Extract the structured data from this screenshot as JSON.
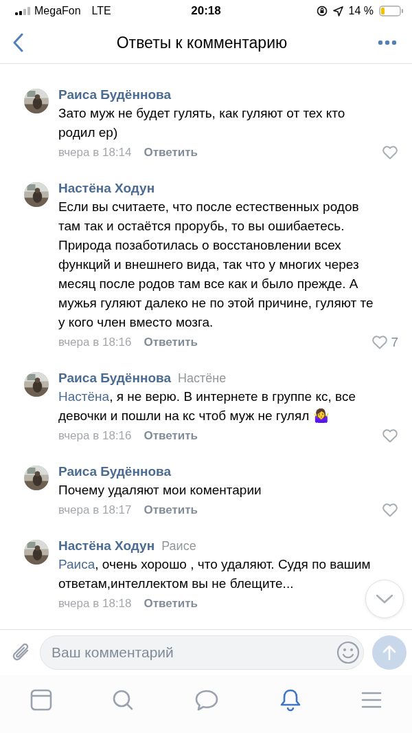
{
  "status_bar": {
    "carrier": "MegaFon",
    "network": "LTE",
    "time": "20:18",
    "battery": "14 %"
  },
  "header": {
    "title": "Ответы к комментарию"
  },
  "comments": [
    {
      "author": "Раиса Будённова",
      "text": "Зато муж не будет гулять, как гуляют от тех кто родил ер)",
      "time": "вчера в 18:14",
      "reply_label": "Ответить"
    },
    {
      "author": "Настёна Ходун",
      "text": "Если вы считаете, что после естественных родов там так и остаётся прорубь, то вы ошибаетесь. Природа позаботилась о восстановлении всех функций и внешнего вида, так что у многих через месяц после родов там все как и было прежде. А мужья гуляют далеко не по этой причине, гуляют те у кого член вместо мозга.",
      "time": "вчера в 18:16",
      "reply_label": "Ответить",
      "likes": "7"
    },
    {
      "author": "Раиса Будённова",
      "reply_to": "Настёне",
      "mention": "Настёна",
      "text": ", я не верю. В интернете в группе кс, все девочки и пошли на кс чтоб муж не гулял 🤷‍♀️",
      "time": "вчера в 18:16",
      "reply_label": "Ответить"
    },
    {
      "author": "Раиса Будённова",
      "text": "Почему удаляют мои коментарии",
      "time": "вчера в 18:17",
      "reply_label": "Ответить"
    },
    {
      "author": "Настёна Ходун",
      "reply_to": "Раисе",
      "mention": "Раиса",
      "text": ", очень хорошо , что удаляют. Судя по вашим ответам,интеллектом вы не блещите...",
      "time": "вчера в 18:18",
      "reply_label": "Ответить",
      "like_hidden": true
    }
  ],
  "composer": {
    "placeholder": "Ваш комментарий"
  },
  "tabbar": [
    {
      "kind": "news",
      "selected": false
    },
    {
      "kind": "search",
      "selected": false
    },
    {
      "kind": "messages",
      "selected": false
    },
    {
      "kind": "notifications",
      "selected": true
    },
    {
      "kind": "menu",
      "selected": false
    }
  ]
}
